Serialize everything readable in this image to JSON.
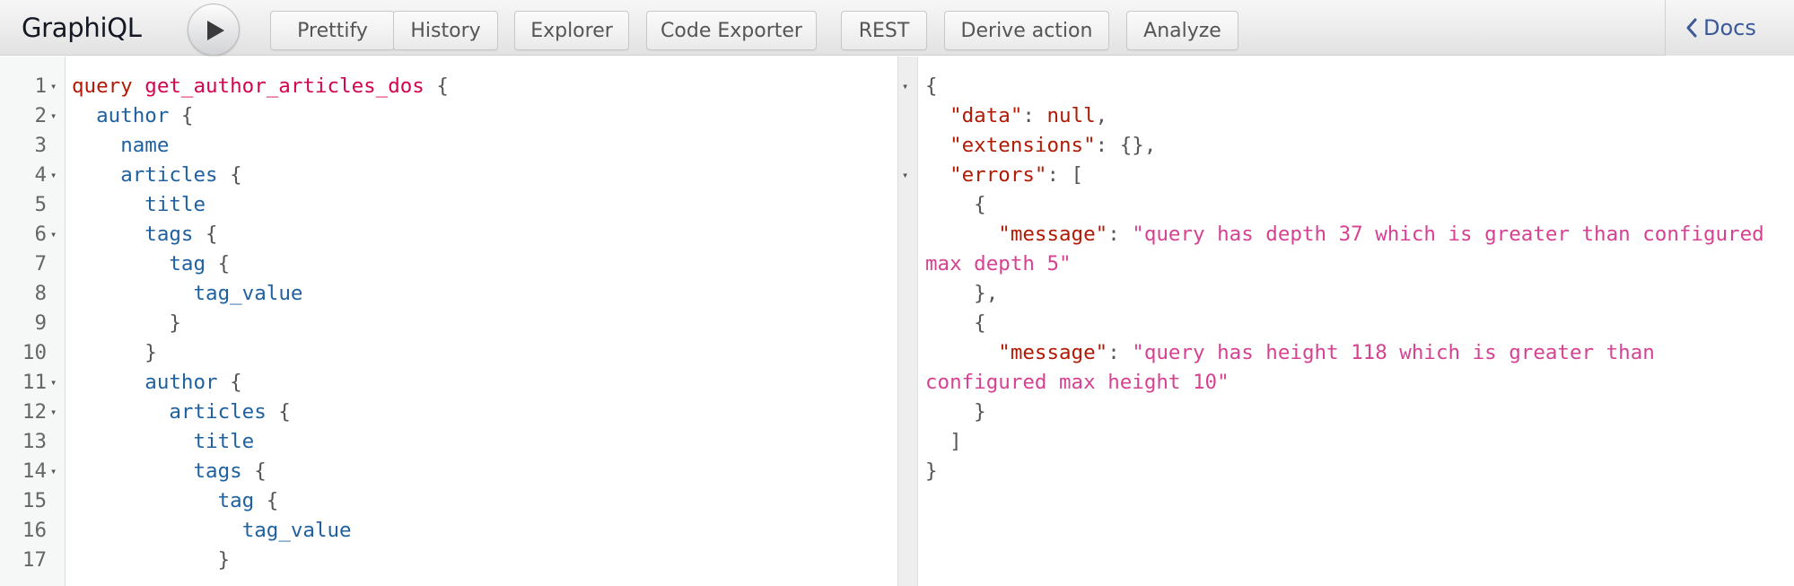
{
  "app": {
    "title": "GraphiQL"
  },
  "toolbar": {
    "execute_label": "Execute query",
    "buttons": [
      {
        "id": "prettify",
        "label": "Prettify"
      },
      {
        "id": "history",
        "label": "History"
      },
      {
        "id": "explorer",
        "label": "Explorer"
      },
      {
        "id": "code-exporter",
        "label": "Code Exporter"
      },
      {
        "id": "rest",
        "label": "REST"
      },
      {
        "id": "derive-action",
        "label": "Derive action"
      },
      {
        "id": "analyze",
        "label": "Analyze"
      }
    ],
    "docs_label": "Docs"
  },
  "editor": {
    "lines": [
      {
        "n": "1",
        "fold": true,
        "indent": 0,
        "tokens": [
          [
            "kw",
            "query"
          ],
          [
            "punc",
            " "
          ],
          [
            "qname",
            "get_author_articles_dos"
          ],
          [
            "punc",
            " {"
          ]
        ]
      },
      {
        "n": "2",
        "fold": true,
        "indent": 1,
        "tokens": [
          [
            "field",
            "author"
          ],
          [
            "punc",
            " {"
          ]
        ]
      },
      {
        "n": "3",
        "fold": false,
        "indent": 2,
        "tokens": [
          [
            "field",
            "name"
          ]
        ]
      },
      {
        "n": "4",
        "fold": true,
        "indent": 2,
        "tokens": [
          [
            "field",
            "articles"
          ],
          [
            "punc",
            " {"
          ]
        ]
      },
      {
        "n": "5",
        "fold": false,
        "indent": 3,
        "tokens": [
          [
            "field",
            "title"
          ]
        ]
      },
      {
        "n": "6",
        "fold": true,
        "indent": 3,
        "tokens": [
          [
            "field",
            "tags"
          ],
          [
            "punc",
            " {"
          ]
        ]
      },
      {
        "n": "7",
        "fold": false,
        "indent": 4,
        "tokens": [
          [
            "field",
            "tag"
          ],
          [
            "punc",
            " {"
          ]
        ]
      },
      {
        "n": "8",
        "fold": false,
        "indent": 5,
        "tokens": [
          [
            "field",
            "tag_value"
          ]
        ]
      },
      {
        "n": "9",
        "fold": false,
        "indent": 4,
        "tokens": [
          [
            "punc",
            "}"
          ]
        ]
      },
      {
        "n": "10",
        "fold": false,
        "indent": 3,
        "tokens": [
          [
            "punc",
            "}"
          ]
        ]
      },
      {
        "n": "11",
        "fold": true,
        "indent": 3,
        "tokens": [
          [
            "field",
            "author"
          ],
          [
            "punc",
            " {"
          ]
        ]
      },
      {
        "n": "12",
        "fold": true,
        "indent": 4,
        "tokens": [
          [
            "field",
            "articles"
          ],
          [
            "punc",
            " {"
          ]
        ]
      },
      {
        "n": "13",
        "fold": false,
        "indent": 5,
        "tokens": [
          [
            "field",
            "title"
          ]
        ]
      },
      {
        "n": "14",
        "fold": true,
        "indent": 5,
        "tokens": [
          [
            "field",
            "tags"
          ],
          [
            "punc",
            " {"
          ]
        ]
      },
      {
        "n": "15",
        "fold": false,
        "indent": 6,
        "tokens": [
          [
            "field",
            "tag"
          ],
          [
            "punc",
            " {"
          ]
        ]
      },
      {
        "n": "16",
        "fold": false,
        "indent": 7,
        "tokens": [
          [
            "field",
            "tag_value"
          ]
        ]
      },
      {
        "n": "17",
        "fold": false,
        "indent": 6,
        "tokens": [
          [
            "punc",
            "}"
          ]
        ]
      }
    ]
  },
  "results": {
    "lines": [
      {
        "fold": true,
        "tokens": [
          [
            "punc",
            "{"
          ]
        ]
      },
      {
        "fold": false,
        "tokens": [
          [
            "punc",
            "  "
          ],
          [
            "key",
            "\"data\""
          ],
          [
            "punc",
            ": "
          ],
          [
            "kw-null",
            "null"
          ],
          [
            "punc",
            ","
          ]
        ]
      },
      {
        "fold": false,
        "tokens": [
          [
            "punc",
            "  "
          ],
          [
            "key",
            "\"extensions\""
          ],
          [
            "punc",
            ": {},"
          ]
        ]
      },
      {
        "fold": true,
        "tokens": [
          [
            "punc",
            "  "
          ],
          [
            "key",
            "\"errors\""
          ],
          [
            "punc",
            ": ["
          ]
        ]
      },
      {
        "fold": false,
        "tokens": [
          [
            "punc",
            "    {"
          ]
        ]
      },
      {
        "fold": false,
        "tokens": [
          [
            "punc",
            "      "
          ],
          [
            "key",
            "\"message\""
          ],
          [
            "punc",
            ": "
          ],
          [
            "str",
            "\"query has depth 37 which is greater than configured"
          ]
        ]
      },
      {
        "fold": false,
        "tokens": [
          [
            "str",
            "max depth 5\""
          ]
        ]
      },
      {
        "fold": false,
        "tokens": [
          [
            "punc",
            "    },"
          ]
        ]
      },
      {
        "fold": false,
        "tokens": [
          [
            "punc",
            "    {"
          ]
        ]
      },
      {
        "fold": false,
        "tokens": [
          [
            "punc",
            "      "
          ],
          [
            "key",
            "\"message\""
          ],
          [
            "punc",
            ": "
          ],
          [
            "str",
            "\"query has height 118 which is greater than"
          ]
        ]
      },
      {
        "fold": false,
        "tokens": [
          [
            "str",
            "configured max height 10\""
          ]
        ]
      },
      {
        "fold": false,
        "tokens": [
          [
            "punc",
            "    }"
          ]
        ]
      },
      {
        "fold": false,
        "tokens": [
          [
            "punc",
            "  ]"
          ]
        ]
      },
      {
        "fold": false,
        "tokens": [
          [
            "punc",
            "}"
          ]
        ]
      }
    ]
  },
  "colors": {
    "keyword": "#b11a04",
    "query_name": "#d2054e",
    "field": "#1f61a0",
    "string": "#d64292",
    "docs_link": "#3b5998"
  }
}
